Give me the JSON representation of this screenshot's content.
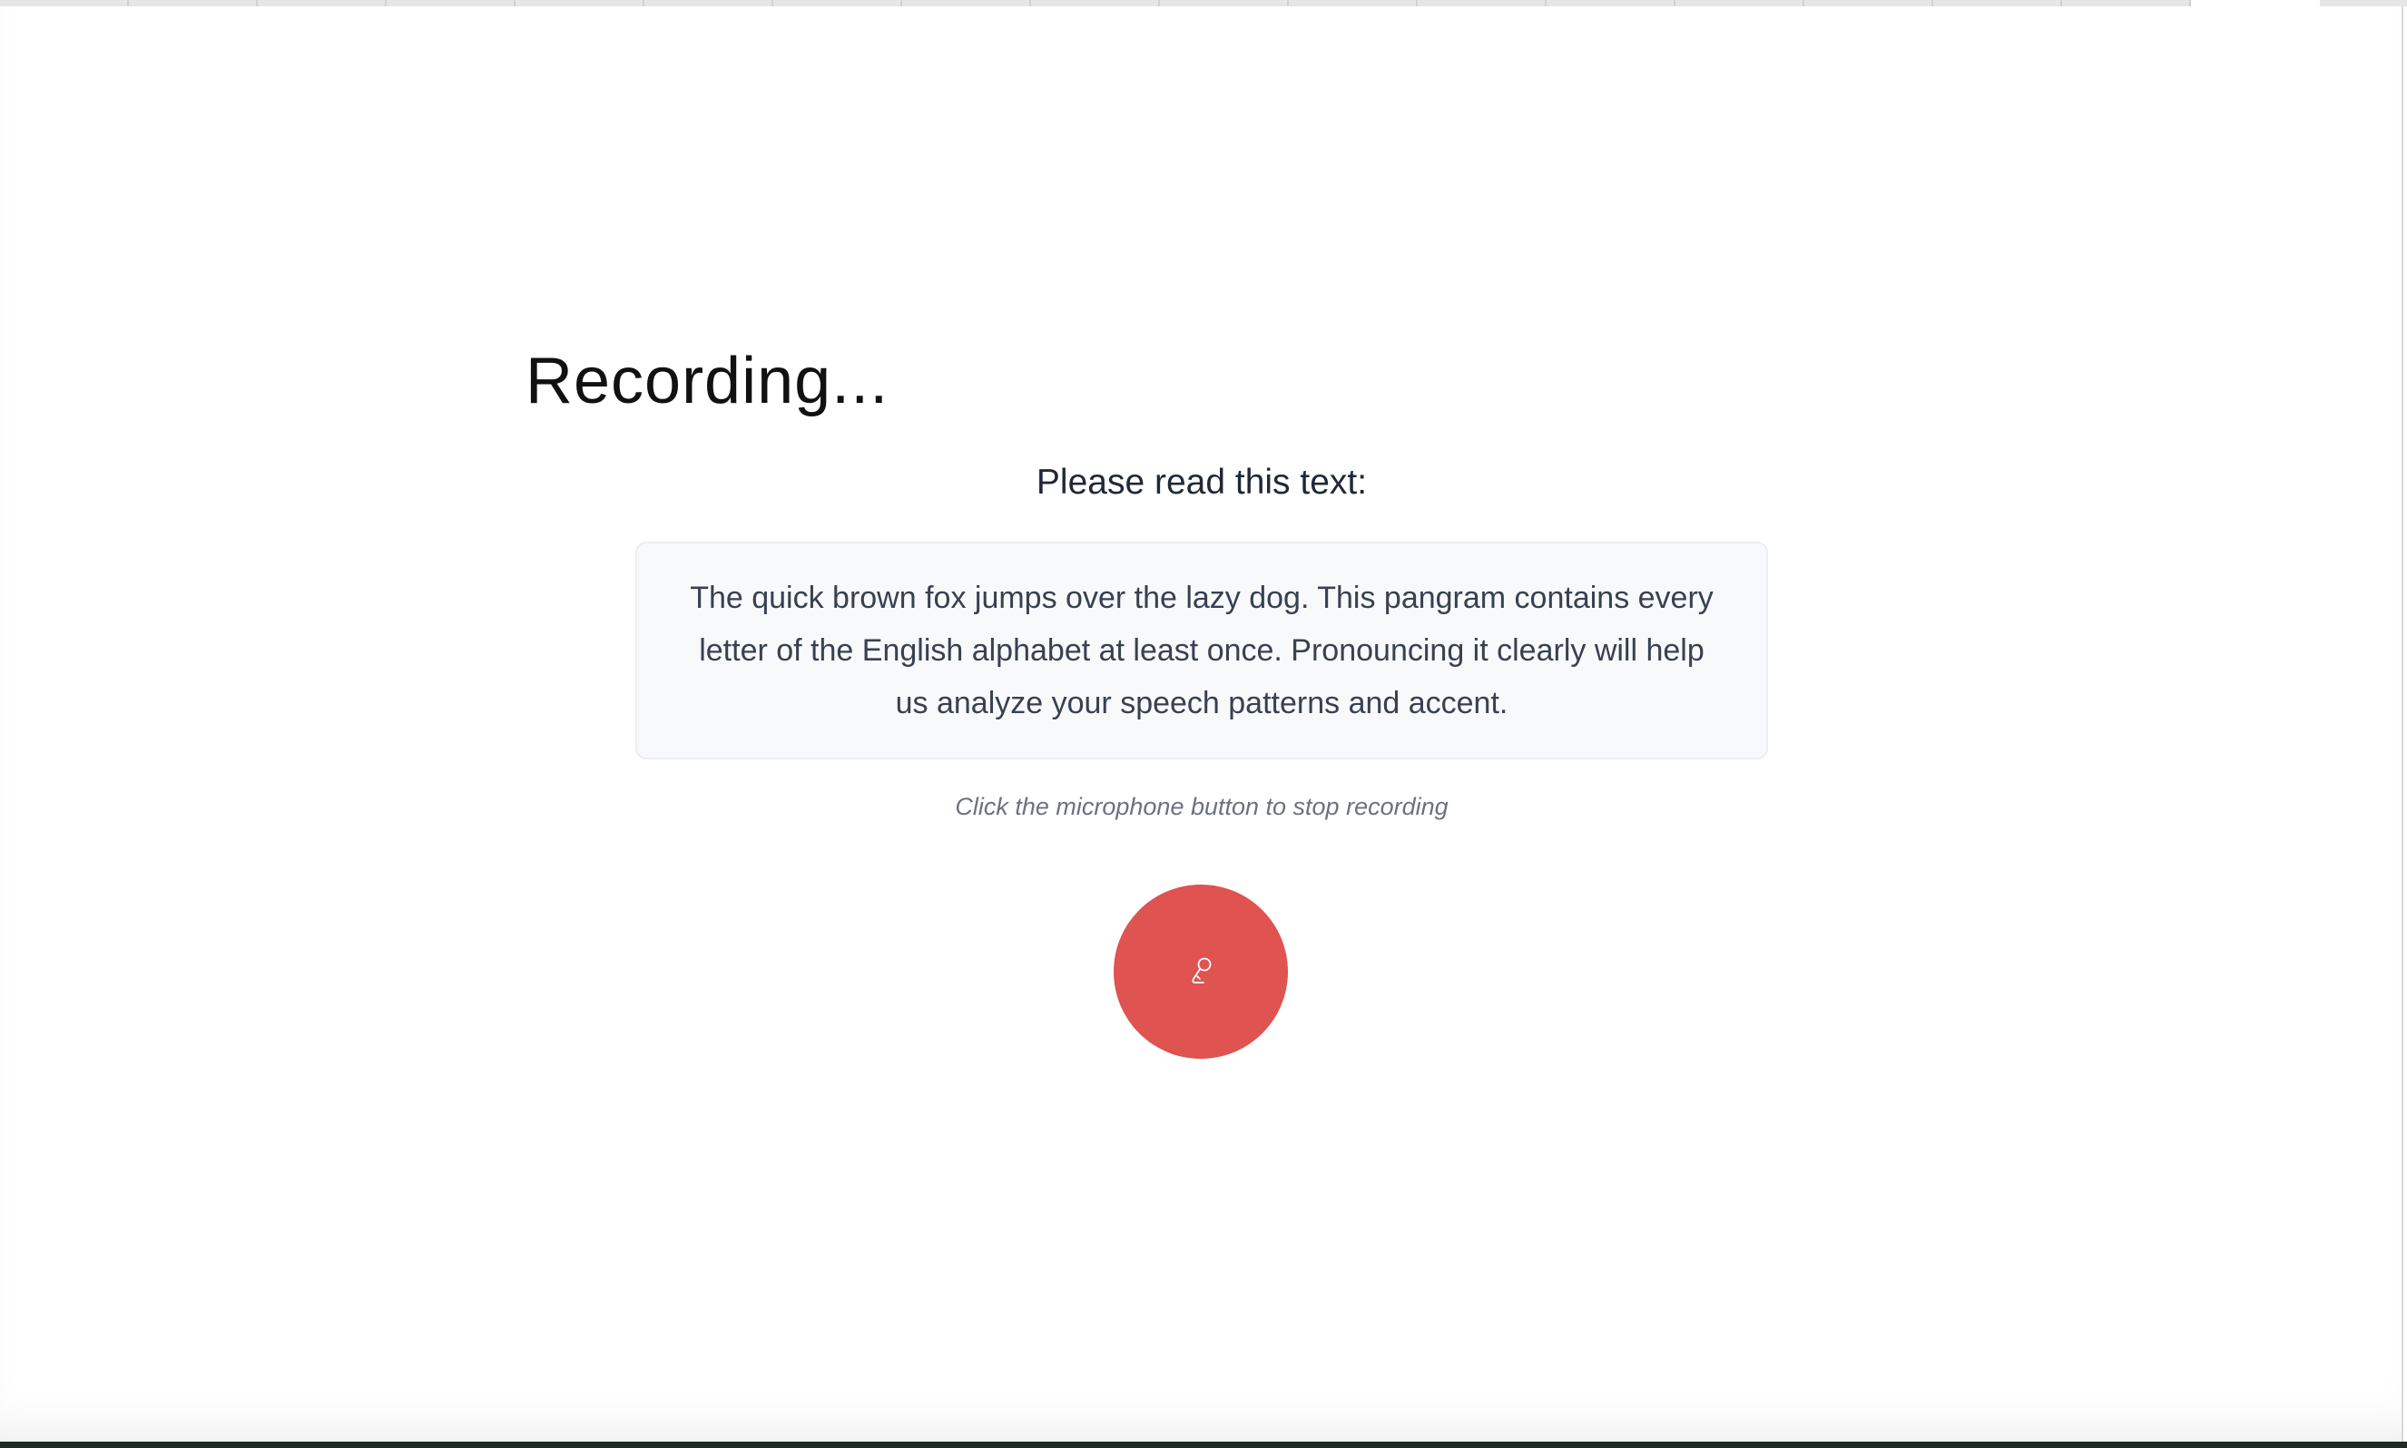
{
  "recording": {
    "title": "Recording...",
    "prompt": "Please read this text:",
    "passage": "The quick brown fox jumps over the lazy dog. This pangram contains every letter of the English alphabet at least once. Pronouncing it clearly will help us analyze your speech patterns and accent.",
    "hint": "Click the microphone button to stop recording",
    "mic_button": {
      "icon": "microphone-icon",
      "color": "#df5350"
    }
  }
}
